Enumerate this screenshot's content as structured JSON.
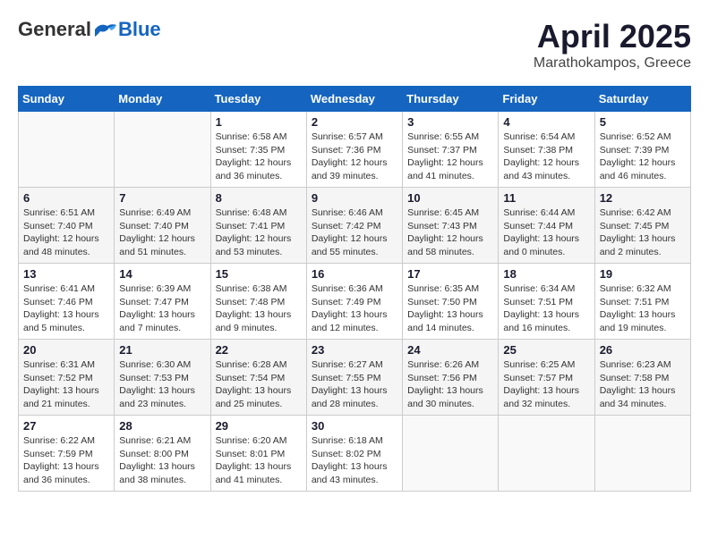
{
  "header": {
    "logo_general": "General",
    "logo_blue": "Blue",
    "month_title": "April 2025",
    "location": "Marathokampos, Greece"
  },
  "weekdays": [
    "Sunday",
    "Monday",
    "Tuesday",
    "Wednesday",
    "Thursday",
    "Friday",
    "Saturday"
  ],
  "weeks": [
    [
      {
        "day": "",
        "text": ""
      },
      {
        "day": "",
        "text": ""
      },
      {
        "day": "1",
        "text": "Sunrise: 6:58 AM\nSunset: 7:35 PM\nDaylight: 12 hours and 36 minutes."
      },
      {
        "day": "2",
        "text": "Sunrise: 6:57 AM\nSunset: 7:36 PM\nDaylight: 12 hours and 39 minutes."
      },
      {
        "day": "3",
        "text": "Sunrise: 6:55 AM\nSunset: 7:37 PM\nDaylight: 12 hours and 41 minutes."
      },
      {
        "day": "4",
        "text": "Sunrise: 6:54 AM\nSunset: 7:38 PM\nDaylight: 12 hours and 43 minutes."
      },
      {
        "day": "5",
        "text": "Sunrise: 6:52 AM\nSunset: 7:39 PM\nDaylight: 12 hours and 46 minutes."
      }
    ],
    [
      {
        "day": "6",
        "text": "Sunrise: 6:51 AM\nSunset: 7:40 PM\nDaylight: 12 hours and 48 minutes."
      },
      {
        "day": "7",
        "text": "Sunrise: 6:49 AM\nSunset: 7:40 PM\nDaylight: 12 hours and 51 minutes."
      },
      {
        "day": "8",
        "text": "Sunrise: 6:48 AM\nSunset: 7:41 PM\nDaylight: 12 hours and 53 minutes."
      },
      {
        "day": "9",
        "text": "Sunrise: 6:46 AM\nSunset: 7:42 PM\nDaylight: 12 hours and 55 minutes."
      },
      {
        "day": "10",
        "text": "Sunrise: 6:45 AM\nSunset: 7:43 PM\nDaylight: 12 hours and 58 minutes."
      },
      {
        "day": "11",
        "text": "Sunrise: 6:44 AM\nSunset: 7:44 PM\nDaylight: 13 hours and 0 minutes."
      },
      {
        "day": "12",
        "text": "Sunrise: 6:42 AM\nSunset: 7:45 PM\nDaylight: 13 hours and 2 minutes."
      }
    ],
    [
      {
        "day": "13",
        "text": "Sunrise: 6:41 AM\nSunset: 7:46 PM\nDaylight: 13 hours and 5 minutes."
      },
      {
        "day": "14",
        "text": "Sunrise: 6:39 AM\nSunset: 7:47 PM\nDaylight: 13 hours and 7 minutes."
      },
      {
        "day": "15",
        "text": "Sunrise: 6:38 AM\nSunset: 7:48 PM\nDaylight: 13 hours and 9 minutes."
      },
      {
        "day": "16",
        "text": "Sunrise: 6:36 AM\nSunset: 7:49 PM\nDaylight: 13 hours and 12 minutes."
      },
      {
        "day": "17",
        "text": "Sunrise: 6:35 AM\nSunset: 7:50 PM\nDaylight: 13 hours and 14 minutes."
      },
      {
        "day": "18",
        "text": "Sunrise: 6:34 AM\nSunset: 7:51 PM\nDaylight: 13 hours and 16 minutes."
      },
      {
        "day": "19",
        "text": "Sunrise: 6:32 AM\nSunset: 7:51 PM\nDaylight: 13 hours and 19 minutes."
      }
    ],
    [
      {
        "day": "20",
        "text": "Sunrise: 6:31 AM\nSunset: 7:52 PM\nDaylight: 13 hours and 21 minutes."
      },
      {
        "day": "21",
        "text": "Sunrise: 6:30 AM\nSunset: 7:53 PM\nDaylight: 13 hours and 23 minutes."
      },
      {
        "day": "22",
        "text": "Sunrise: 6:28 AM\nSunset: 7:54 PM\nDaylight: 13 hours and 25 minutes."
      },
      {
        "day": "23",
        "text": "Sunrise: 6:27 AM\nSunset: 7:55 PM\nDaylight: 13 hours and 28 minutes."
      },
      {
        "day": "24",
        "text": "Sunrise: 6:26 AM\nSunset: 7:56 PM\nDaylight: 13 hours and 30 minutes."
      },
      {
        "day": "25",
        "text": "Sunrise: 6:25 AM\nSunset: 7:57 PM\nDaylight: 13 hours and 32 minutes."
      },
      {
        "day": "26",
        "text": "Sunrise: 6:23 AM\nSunset: 7:58 PM\nDaylight: 13 hours and 34 minutes."
      }
    ],
    [
      {
        "day": "27",
        "text": "Sunrise: 6:22 AM\nSunset: 7:59 PM\nDaylight: 13 hours and 36 minutes."
      },
      {
        "day": "28",
        "text": "Sunrise: 6:21 AM\nSunset: 8:00 PM\nDaylight: 13 hours and 38 minutes."
      },
      {
        "day": "29",
        "text": "Sunrise: 6:20 AM\nSunset: 8:01 PM\nDaylight: 13 hours and 41 minutes."
      },
      {
        "day": "30",
        "text": "Sunrise: 6:18 AM\nSunset: 8:02 PM\nDaylight: 13 hours and 43 minutes."
      },
      {
        "day": "",
        "text": ""
      },
      {
        "day": "",
        "text": ""
      },
      {
        "day": "",
        "text": ""
      }
    ]
  ]
}
